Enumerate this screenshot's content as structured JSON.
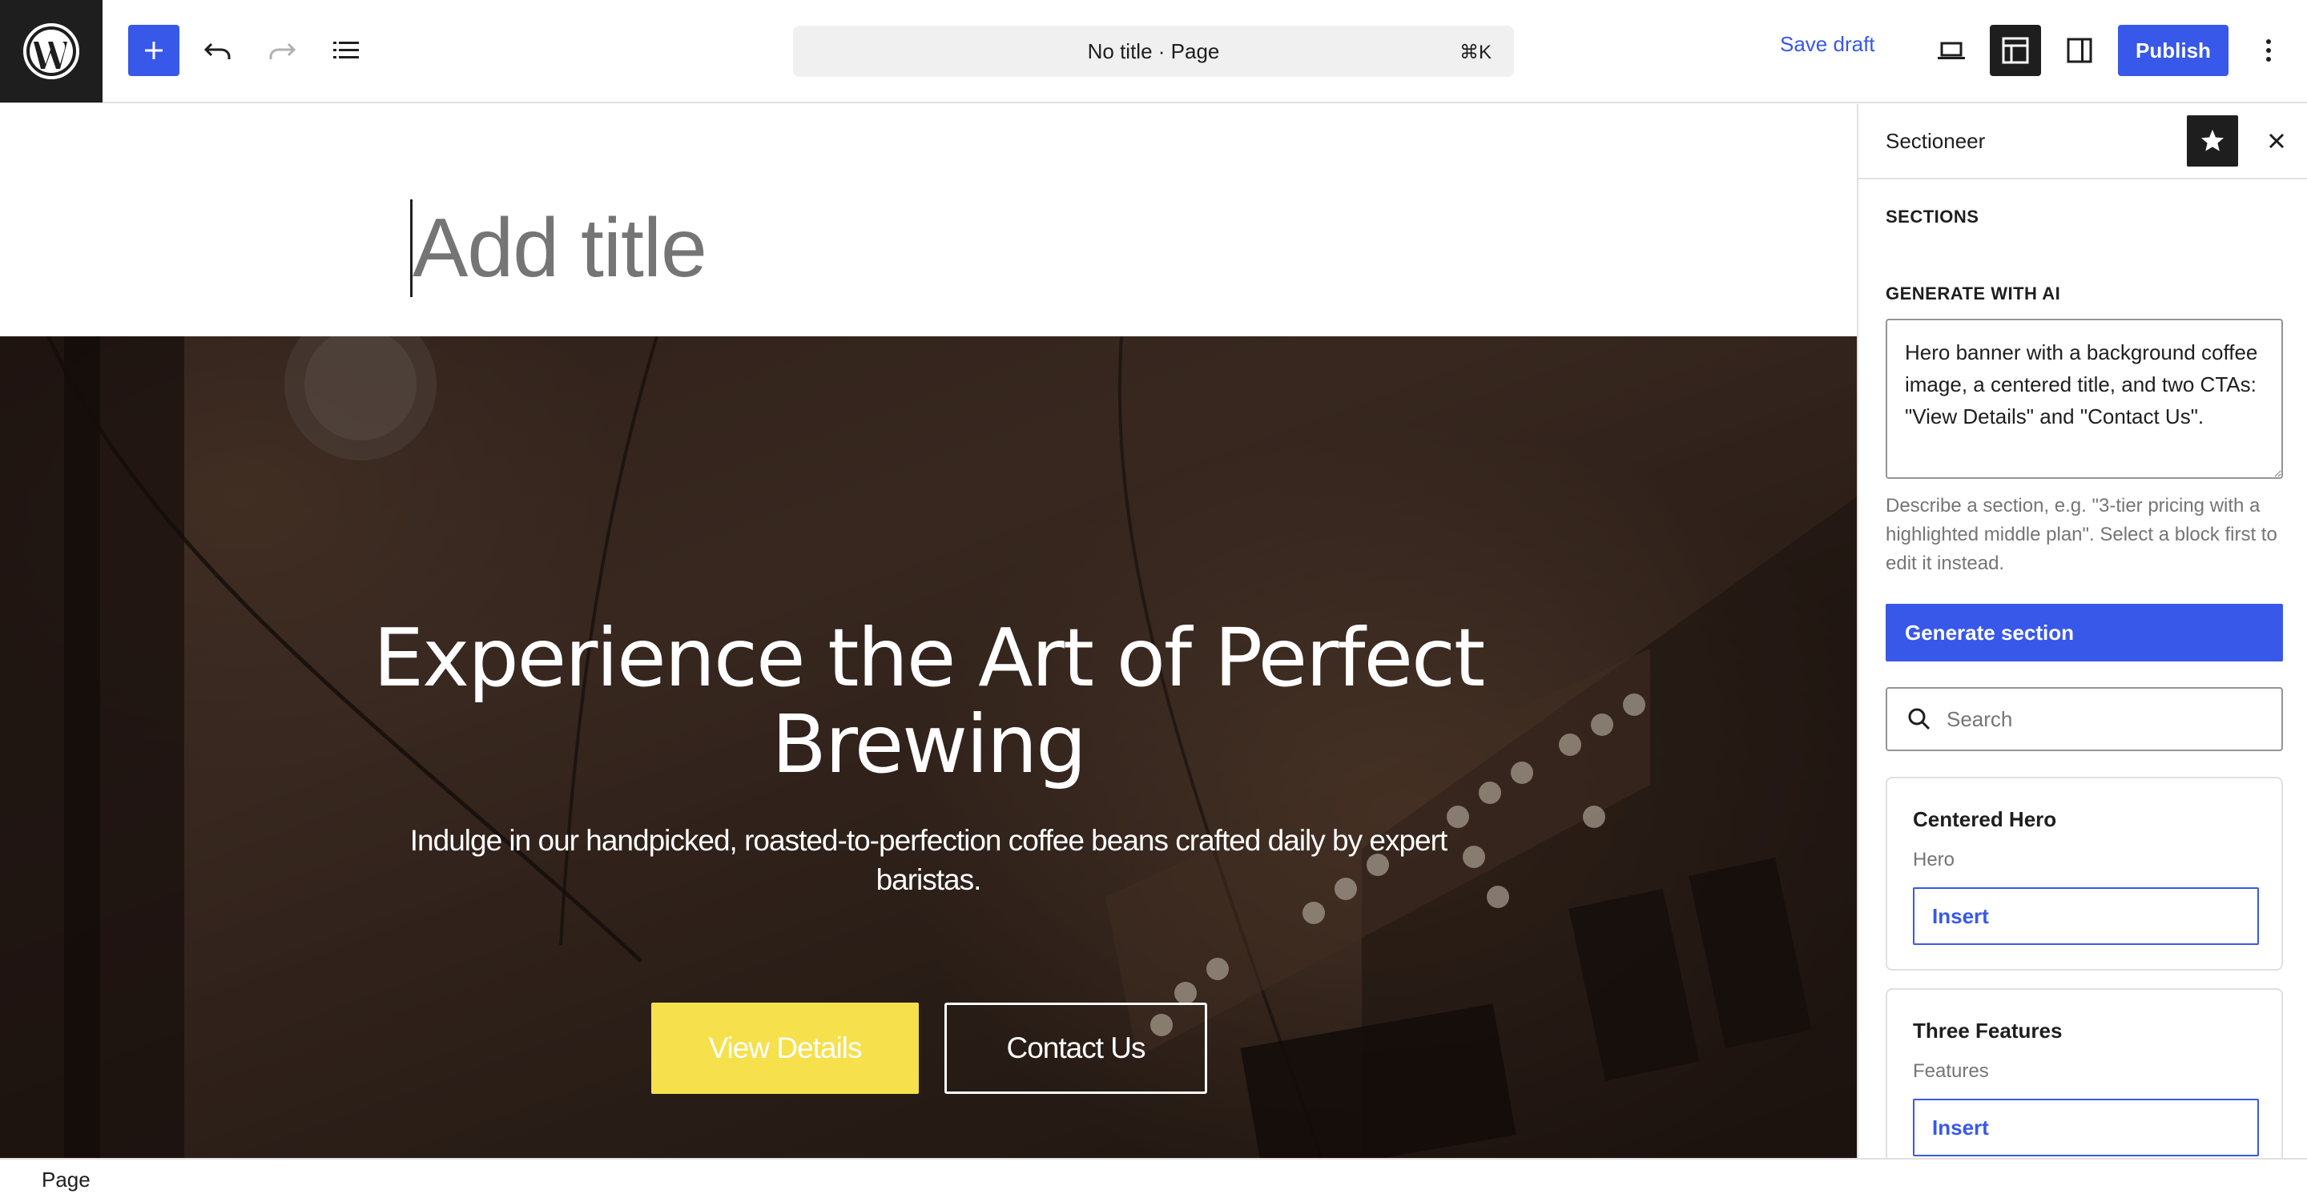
{
  "toolbar": {
    "add_block_label": "Add block",
    "document_title": "No title · Page",
    "shortcut": "⌘K",
    "save_draft": "Save draft",
    "publish": "Publish"
  },
  "editor": {
    "title_placeholder": "Add title"
  },
  "hero": {
    "title": "Experience the Art of Perfect Brewing",
    "subtitle": "Indulge in our handpicked, roasted-to-perfection coffee beans crafted daily by expert baristas.",
    "primary_cta": "View Details",
    "secondary_cta": "Contact Us",
    "primary_color": "#f6e04b"
  },
  "sidebar": {
    "title": "Sectioneer",
    "sections_label": "SECTIONS",
    "generate_label": "GENERATE WITH AI",
    "prompt_value": "Hero banner with a background coffee image, a centered title, and two CTAs: \"View Details\" and \"Contact Us\".",
    "help_text": "Describe a section, e.g. \"3-tier pricing with a highlighted middle plan\". Select a block first to edit it instead.",
    "generate_button": "Generate section",
    "search_placeholder": "Search",
    "cards": [
      {
        "title": "Centered Hero",
        "category": "Hero",
        "action": "Insert"
      },
      {
        "title": "Three Features",
        "category": "Features",
        "action": "Insert"
      }
    ]
  },
  "footer": {
    "breadcrumb": "Page"
  },
  "colors": {
    "accent": "#3858e9",
    "dark": "#1e1e1e",
    "muted": "#757575"
  }
}
